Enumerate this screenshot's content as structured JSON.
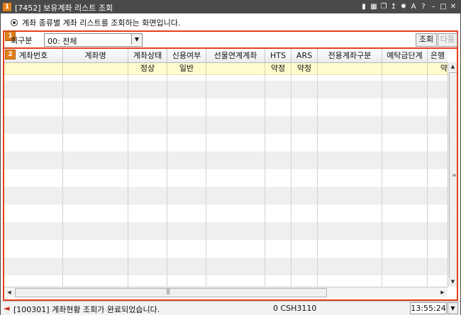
{
  "window": {
    "badge": "1",
    "title": "[7452] 보유계좌 리스트 조회",
    "description": "계좌 종류별 계좌 리스트를 조회하는 화면입니다."
  },
  "panel1": {
    "badge": "1",
    "label": "회구분",
    "combo_value": "00: 전체",
    "query_button": "조회",
    "next_button": "다음"
  },
  "panel2": {
    "badge": "2",
    "headers": [
      "계좌번호",
      "계좌명",
      "계좌상태",
      "신용여부",
      "선물연계계좌",
      "HTS",
      "ARS",
      "전용계좌구분",
      "예탁금단계",
      "은행"
    ],
    "row": [
      "",
      "",
      "정상",
      "일반",
      "",
      "약정",
      "약정",
      "",
      "",
      "약"
    ]
  },
  "status": {
    "message": "[100301] 계좌현황 조회가 완료되었습니다.",
    "code": "0 CSH3110",
    "time": "13:55:24"
  },
  "colors": {
    "titlebar": "#4a4a4a",
    "accent_border": "#e53f1a",
    "badge": "#e07f18",
    "selected_row": "#fffbcc"
  }
}
